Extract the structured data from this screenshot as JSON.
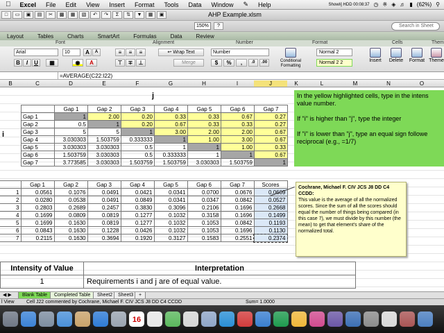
{
  "menubar": {
    "apple": "",
    "items": [
      "Excel",
      "File",
      "Edit",
      "View",
      "Insert",
      "Format",
      "Tools",
      "Data",
      "Window",
      "Help"
    ],
    "battery": "(62%)",
    "clock": "Showl/j HDD 00:08:37"
  },
  "window": {
    "title": "AHP Example.xlsm",
    "zoom": "150%",
    "search_placeholder": "Search in Sheet"
  },
  "ribbon": {
    "tabs": [
      "Layout",
      "Tables",
      "Charts",
      "SmartArt",
      "Formulas",
      "Data",
      "Review"
    ],
    "groups": [
      "Font",
      "Alignment",
      "Number",
      "Format",
      "Cells",
      "Them"
    ],
    "font_name": "Arial",
    "font_size": "10",
    "wrap_text": "Wrap Text",
    "merge": "Merge",
    "number_format": "Number",
    "style_normal2": "Normal 2",
    "style_normal22": "Normal 2 2",
    "conditional_formatting": "Conditional Formatting",
    "insert": "Insert",
    "delete": "Delete",
    "format": "Format",
    "themes": "Theme"
  },
  "formula_bar": {
    "formula": "=AVERAGE(C22:I22)"
  },
  "columns": [
    "B",
    "C",
    "D",
    "E",
    "F",
    "G",
    "H",
    "I",
    "J",
    "K",
    "L",
    "M",
    "N",
    "O"
  ],
  "matrix": {
    "j_label": "j",
    "i_label": "i",
    "headers": [
      "Gap 1",
      "Gap 2",
      "Gap 3",
      "Gap 4",
      "Gap 5",
      "Gap 6",
      "Gap 7"
    ],
    "rows": [
      {
        "label": "Gap 1",
        "cells": [
          "1",
          "2.00",
          "0.20",
          "0.33",
          "0.33",
          "0.67",
          "0.27"
        ]
      },
      {
        "label": "Gap 2",
        "cells": [
          "0.5",
          "1",
          "0.20",
          "0.67",
          "0.33",
          "0.33",
          "0.27"
        ]
      },
      {
        "label": "Gap 3",
        "cells": [
          "5",
          "5",
          "1",
          "3.00",
          "2.00",
          "2.00",
          "0.67"
        ]
      },
      {
        "label": "Gap 4",
        "cells": [
          "3.030303",
          "1.503759",
          "0.333333",
          "1",
          "1.00",
          "3.00",
          "0.67"
        ]
      },
      {
        "label": "Gap 5",
        "cells": [
          "3.030303",
          "3.030303",
          "0.5",
          "1",
          "1",
          "1.00",
          "0.33"
        ]
      },
      {
        "label": "Gap 6",
        "cells": [
          "1.503759",
          "3.030303",
          "0.5",
          "0.333333",
          "1",
          "1",
          "0.67"
        ]
      },
      {
        "label": "Gap 7",
        "cells": [
          "3.773585",
          "3.030303",
          "1.503759",
          "1.503759",
          "3.030303",
          "1.503759",
          "1"
        ]
      }
    ]
  },
  "normalized": {
    "headers": [
      "Gap 1",
      "Gap 2",
      "Gap 3",
      "Gap 4",
      "Gap 5",
      "Gap 6",
      "Gap 7",
      "Scores"
    ],
    "row_labels": [
      "1",
      "2",
      "3",
      "4",
      "5",
      "6",
      "7"
    ],
    "rows": [
      [
        "0.0561",
        "0.1076",
        "0.0491",
        "0.0421",
        "0.0341",
        "0.0700",
        "0.0676",
        "0.0609"
      ],
      [
        "0.0280",
        "0.0538",
        "0.0491",
        "0.0849",
        "0.0341",
        "0.0347",
        "0.0842",
        "0.0527"
      ],
      [
        "0.2803",
        "0.2689",
        "0.2457",
        "0.3830",
        "0.3096",
        "0.2106",
        "0.1696",
        "0.2668"
      ],
      [
        "0.1699",
        "0.0809",
        "0.0819",
        "0.1277",
        "0.1032",
        "0.3158",
        "0.1696",
        "0.1499"
      ],
      [
        "0.1699",
        "0.1630",
        "0.0819",
        "0.1277",
        "0.1032",
        "0.1053",
        "0.0842",
        "0.1193"
      ],
      [
        "0.0843",
        "0.1630",
        "0.1228",
        "0.0426",
        "0.1032",
        "0.1053",
        "0.1696",
        "0.1130"
      ],
      [
        "0.2115",
        "0.1630",
        "0.3694",
        "0.1920",
        "0.3127",
        "0.1583",
        "0.2551",
        "0.2374"
      ]
    ]
  },
  "instructions": {
    "p1": "In the yellow highlighted cells, type in the intens value number.",
    "p2": "If \"i\" is higher than \"j\", type the integer",
    "p3": "If \"i\" is lower than \"j\", type an equal sign followe reciprocal (e.g., =1/7)"
  },
  "comment": {
    "author": "Cochrane, Michael F. CIV JCS J8 DD C4 CCDD:",
    "text": "This value is the average of all the normalized scores. Since the sum of all the scores should equal the number of things being compared (in this case 7), we must divide by this number (the mean) to get that element's share of the normalized total."
  },
  "intensity_table": {
    "h1": "Intensity of Value",
    "h2": "Interpretation",
    "value": "1",
    "interpretation": "Requirements i and j are of equal value."
  },
  "sheet_tabs": [
    "Blank Table",
    "Completed Table",
    "Sheet2",
    "Sheet3"
  ],
  "status": {
    "view": "l View",
    "comment_info": "Cell J22 commented by Cochrane, Michael F. CIV JCS J8 DD C4 CCDD",
    "sum": "Sum= 1.0000"
  },
  "dock": {
    "calendar_day": "16",
    "colors": [
      "#6f7785",
      "#3b82d6",
      "#7d8da0",
      "#4a90d9",
      "#c9a36b",
      "#2e7bd6",
      "#9aa4b1",
      "#e45a34",
      "#e7e7e7",
      "#5bb85d",
      "#d6d6d6",
      "#8fa6c8",
      "#2a8fd6",
      "#d23b3b",
      "#3a7fd0",
      "#1e9a4e",
      "#f0b73a",
      "#d14b8f",
      "#6b57a6",
      "#3c6fb5",
      "#8c8c8c",
      "#d9d9d9",
      "#a55",
      "#4c7fc0"
    ]
  }
}
